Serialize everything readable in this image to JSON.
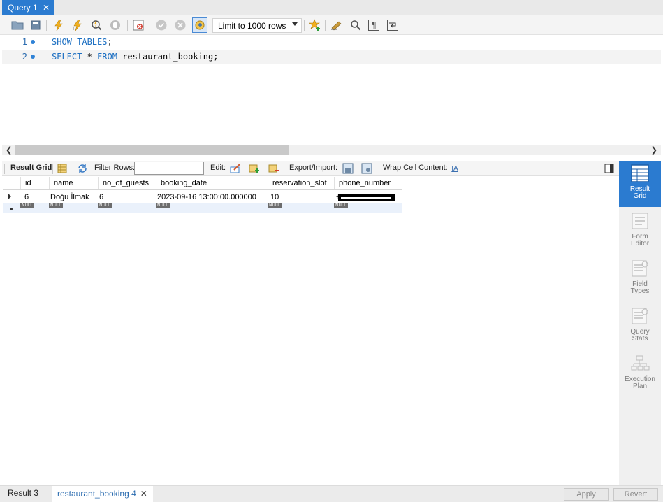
{
  "tabs": {
    "query_tab": "Query 1",
    "close": "✕"
  },
  "toolbar": {
    "limit_select": "Limit to 1000 rows",
    "icons": [
      "open-folder-icon",
      "save-icon",
      "execute-icon",
      "execute-current-icon",
      "explain-icon",
      "stop-icon",
      "toggle-continue-on-error-icon",
      "commit-icon",
      "rollback-icon",
      "autocommit-icon",
      "add-snippet-icon",
      "beautify-icon",
      "find-icon",
      "invisible-chars-icon",
      "wrap-icon"
    ]
  },
  "editor": {
    "lines": [
      {
        "num": "1",
        "kw1": "SHOW TABLES",
        "rest1": ";"
      },
      {
        "num": "2",
        "kw1": "SELECT",
        "mid": " * ",
        "kw2": "FROM",
        "rest2": " restaurant_booking;"
      }
    ]
  },
  "result_toolbar": {
    "result_grid": "Result Grid",
    "filter_rows": "Filter Rows:",
    "edit": "Edit:",
    "export_import": "Export/Import:",
    "wrap_cell": "Wrap Cell Content:"
  },
  "grid": {
    "columns": [
      "id",
      "name",
      "no_of_guests",
      "booking_date",
      "reservation_slot",
      "phone_number"
    ],
    "row": [
      "6",
      "Doğu İlmak",
      "6",
      "2023-09-16 13:00:00.000000",
      "10",
      "+"
    ],
    "null_label": "NULL"
  },
  "sidepanel": {
    "result_grid": [
      "Result",
      "Grid"
    ],
    "form_editor": [
      "Form",
      "Editor"
    ],
    "field_types": [
      "Field",
      "Types"
    ],
    "query_stats": [
      "Query",
      "Stats"
    ],
    "execution_plan": [
      "Execution",
      "Plan"
    ]
  },
  "bottom": {
    "tab1": "Result 3",
    "tab2": "restaurant_booking 4",
    "close": "✕",
    "apply": "Apply",
    "revert": "Revert"
  },
  "colors": {
    "accent": "#2b7bd0",
    "keyword": "#1c6fc2",
    "null_badge": "#6c6c6c"
  }
}
